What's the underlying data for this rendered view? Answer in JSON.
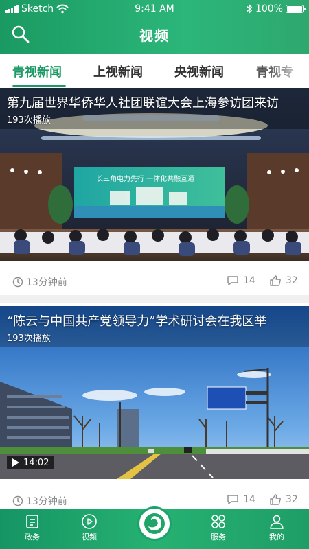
{
  "status_bar": {
    "carrier": "Sketch",
    "time": "9:41 AM",
    "battery": "100%"
  },
  "header": {
    "title": "视频"
  },
  "tabs": [
    {
      "label": "青视新闻",
      "active": true
    },
    {
      "label": "上视新闻",
      "active": false
    },
    {
      "label": "央视新闻",
      "active": false
    },
    {
      "label": "青视专",
      "active": false
    }
  ],
  "videos": [
    {
      "title": "第九届世界华侨华人社团联谊大会上海参访团来访",
      "plays": "193次播放",
      "banner_text": "长三角电力先行 一体化共融互通",
      "time_ago": "13分钟前",
      "comments": "14",
      "likes": "32"
    },
    {
      "title": "“陈云与中国共产党领导力”学术研讨会在我区举",
      "plays": "193次播放",
      "duration": "14:02",
      "time_ago": "13分钟前",
      "comments": "14",
      "likes": "32"
    }
  ],
  "bottom_nav": [
    {
      "label": "政务",
      "icon": "document-icon"
    },
    {
      "label": "视频",
      "icon": "play-circle-icon"
    },
    {
      "label": "",
      "icon": "app-logo-icon"
    },
    {
      "label": "服务",
      "icon": "grid-icon"
    },
    {
      "label": "我的",
      "icon": "user-icon"
    }
  ],
  "colors": {
    "brand": "#1d9a66",
    "nav_gradient_start": "#159564",
    "nav_gradient_end": "#26b172"
  }
}
